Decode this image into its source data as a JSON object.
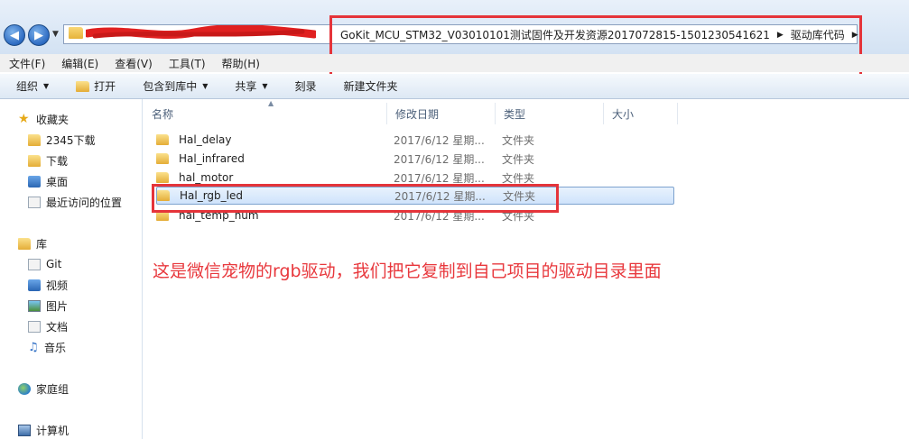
{
  "address_bar": {
    "path": [
      "GoKit_MCU_STM32_V03010101测试固件及开发资源2017072815-1501230541621",
      "驱动库代码"
    ],
    "back_icon": "arrow-left-icon",
    "forward_icon": "arrow-right-icon"
  },
  "menu": [
    "文件(F)",
    "编辑(E)",
    "查看(V)",
    "工具(T)",
    "帮助(H)"
  ],
  "toolbar": {
    "organize": "组织",
    "open": "打开",
    "include_in_library": "包含到库中",
    "share": "共享",
    "burn": "刻录",
    "new_folder": "新建文件夹"
  },
  "sidebar": {
    "favorites": "收藏夹",
    "favorites_items": [
      "2345下载",
      "下载",
      "桌面",
      "最近访问的位置"
    ],
    "libraries": "库",
    "library_items": [
      "Git",
      "视频",
      "图片",
      "文档",
      "音乐"
    ],
    "homegroup": "家庭组",
    "computer": "计算机"
  },
  "columns": [
    "名称",
    "修改日期",
    "类型",
    "大小"
  ],
  "files": [
    {
      "name": "Hal_delay",
      "date": "2017/6/12 星期...",
      "type": "文件夹"
    },
    {
      "name": "Hal_infrared",
      "date": "2017/6/12 星期...",
      "type": "文件夹"
    },
    {
      "name": "hal_motor",
      "date": "2017/6/12 星期...",
      "type": "文件夹"
    },
    {
      "name": "Hal_rgb_led",
      "date": "2017/6/12 星期...",
      "type": "文件夹"
    },
    {
      "name": "hal_temp_hum",
      "date": "2017/6/12 星期...",
      "type": "文件夹"
    }
  ],
  "selected_file": "Hal_rgb_led",
  "annotation": "这是微信宠物的rgb驱动，我们把它复制到自己项目的驱动目录里面",
  "colors": {
    "annotation": "#e8383d",
    "highlight_box": "#e5343a",
    "selection": "#cfe3fb"
  }
}
